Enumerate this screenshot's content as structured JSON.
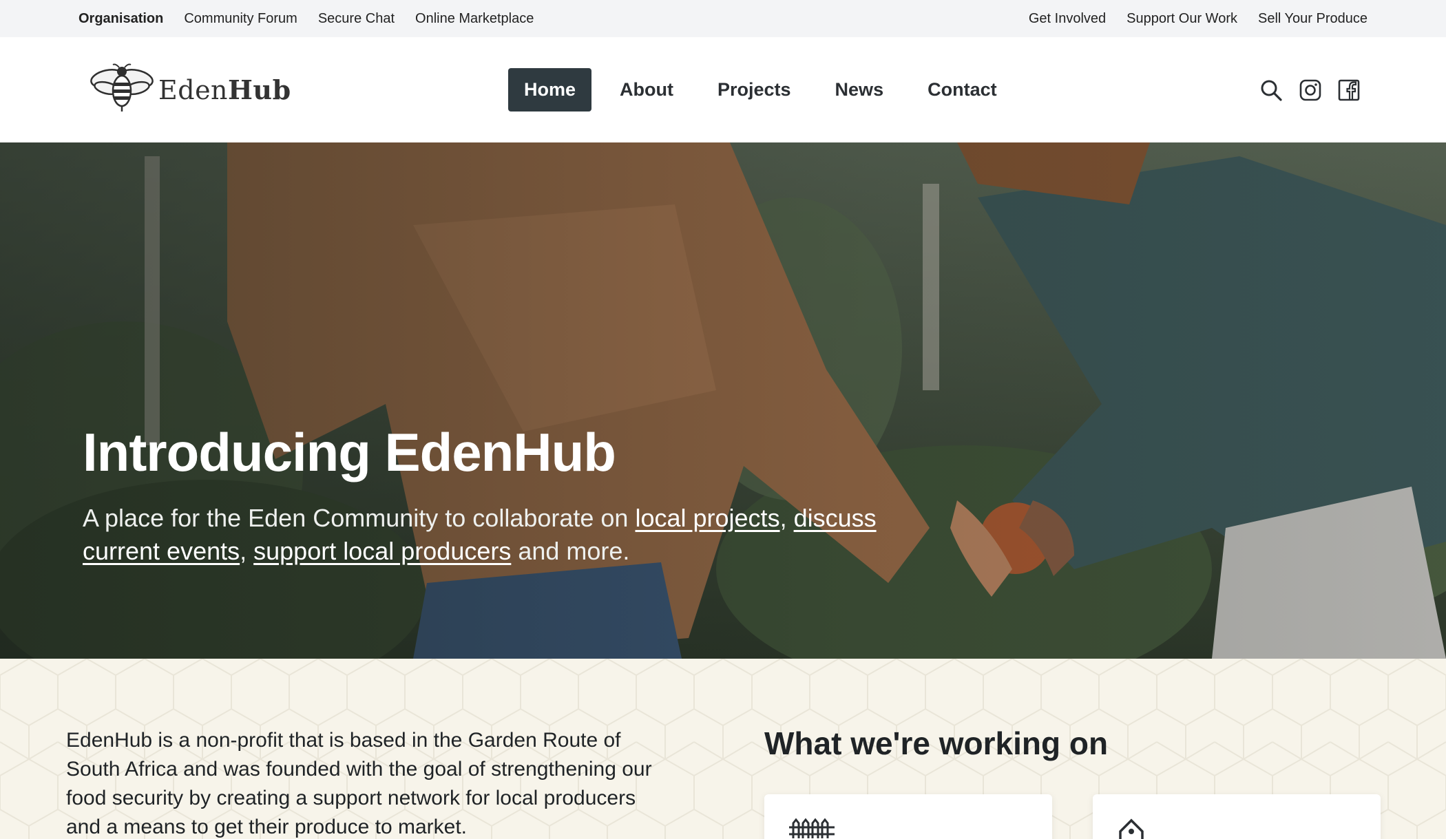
{
  "utility_nav": {
    "left": [
      "Organisation",
      "Community Forum",
      "Secure Chat",
      "Online Marketplace"
    ],
    "right": [
      "Get Involved",
      "Support Our Work",
      "Sell Your Produce"
    ]
  },
  "header": {
    "logo": {
      "first": "Eden",
      "second": "Hub"
    },
    "nav": [
      "Home",
      "About",
      "Projects",
      "News",
      "Contact"
    ],
    "active_nav": "Home",
    "icons": [
      "search-icon",
      "instagram-icon",
      "facebook-icon"
    ]
  },
  "hero": {
    "title": "Introducing EdenHub",
    "subtitle_pre": "A place for the Eden Community to collaborate on ",
    "link_projects": "local projects",
    "comma1": ", ",
    "link_events": "discuss current events",
    "comma2": ", ",
    "link_producers": "support local producers",
    "subtitle_post": " and more."
  },
  "about": {
    "text": "EdenHub is a non-profit that is based in the Garden Route of South Africa and was founded with the goal of strengthening our food security by creating a support network for local producers and a means to get their produce to market."
  },
  "working": {
    "heading": "What we're working on",
    "cards": [
      {
        "icon": "fence-icon"
      },
      {
        "icon": "tag-icon"
      }
    ]
  },
  "colors": {
    "utility_bg": "#f3f4f6",
    "nav_active_bg": "#2f3a40",
    "lower_bg": "#f7f4ea"
  }
}
